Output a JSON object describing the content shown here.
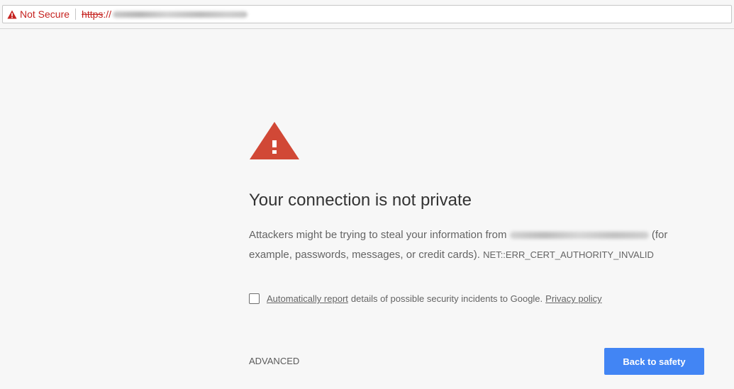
{
  "address_bar": {
    "security_label": "Not Secure",
    "security_icon": "warning-triangle-icon",
    "url_scheme": "https",
    "url_separator": "://",
    "url_host_blurred": true,
    "security_color": "#c5221f"
  },
  "interstitial": {
    "icon": "warning-triangle-icon",
    "icon_color": "#d14836",
    "heading": "Your connection is not private",
    "message_before_host": "Attackers might be trying to steal your information from",
    "host_blurred": true,
    "message_after_host": "(for example, passwords, messages, or credit cards).",
    "error_code": "NET::ERR_CERT_AUTHORITY_INVALID",
    "report": {
      "checked": false,
      "link_label": "Automatically report",
      "text": "details of possible security incidents to Google.",
      "privacy_link_label": "Privacy policy"
    },
    "advanced_label": "ADVANCED",
    "primary_button_label": "Back to safety",
    "primary_button_color": "#4285f4"
  }
}
